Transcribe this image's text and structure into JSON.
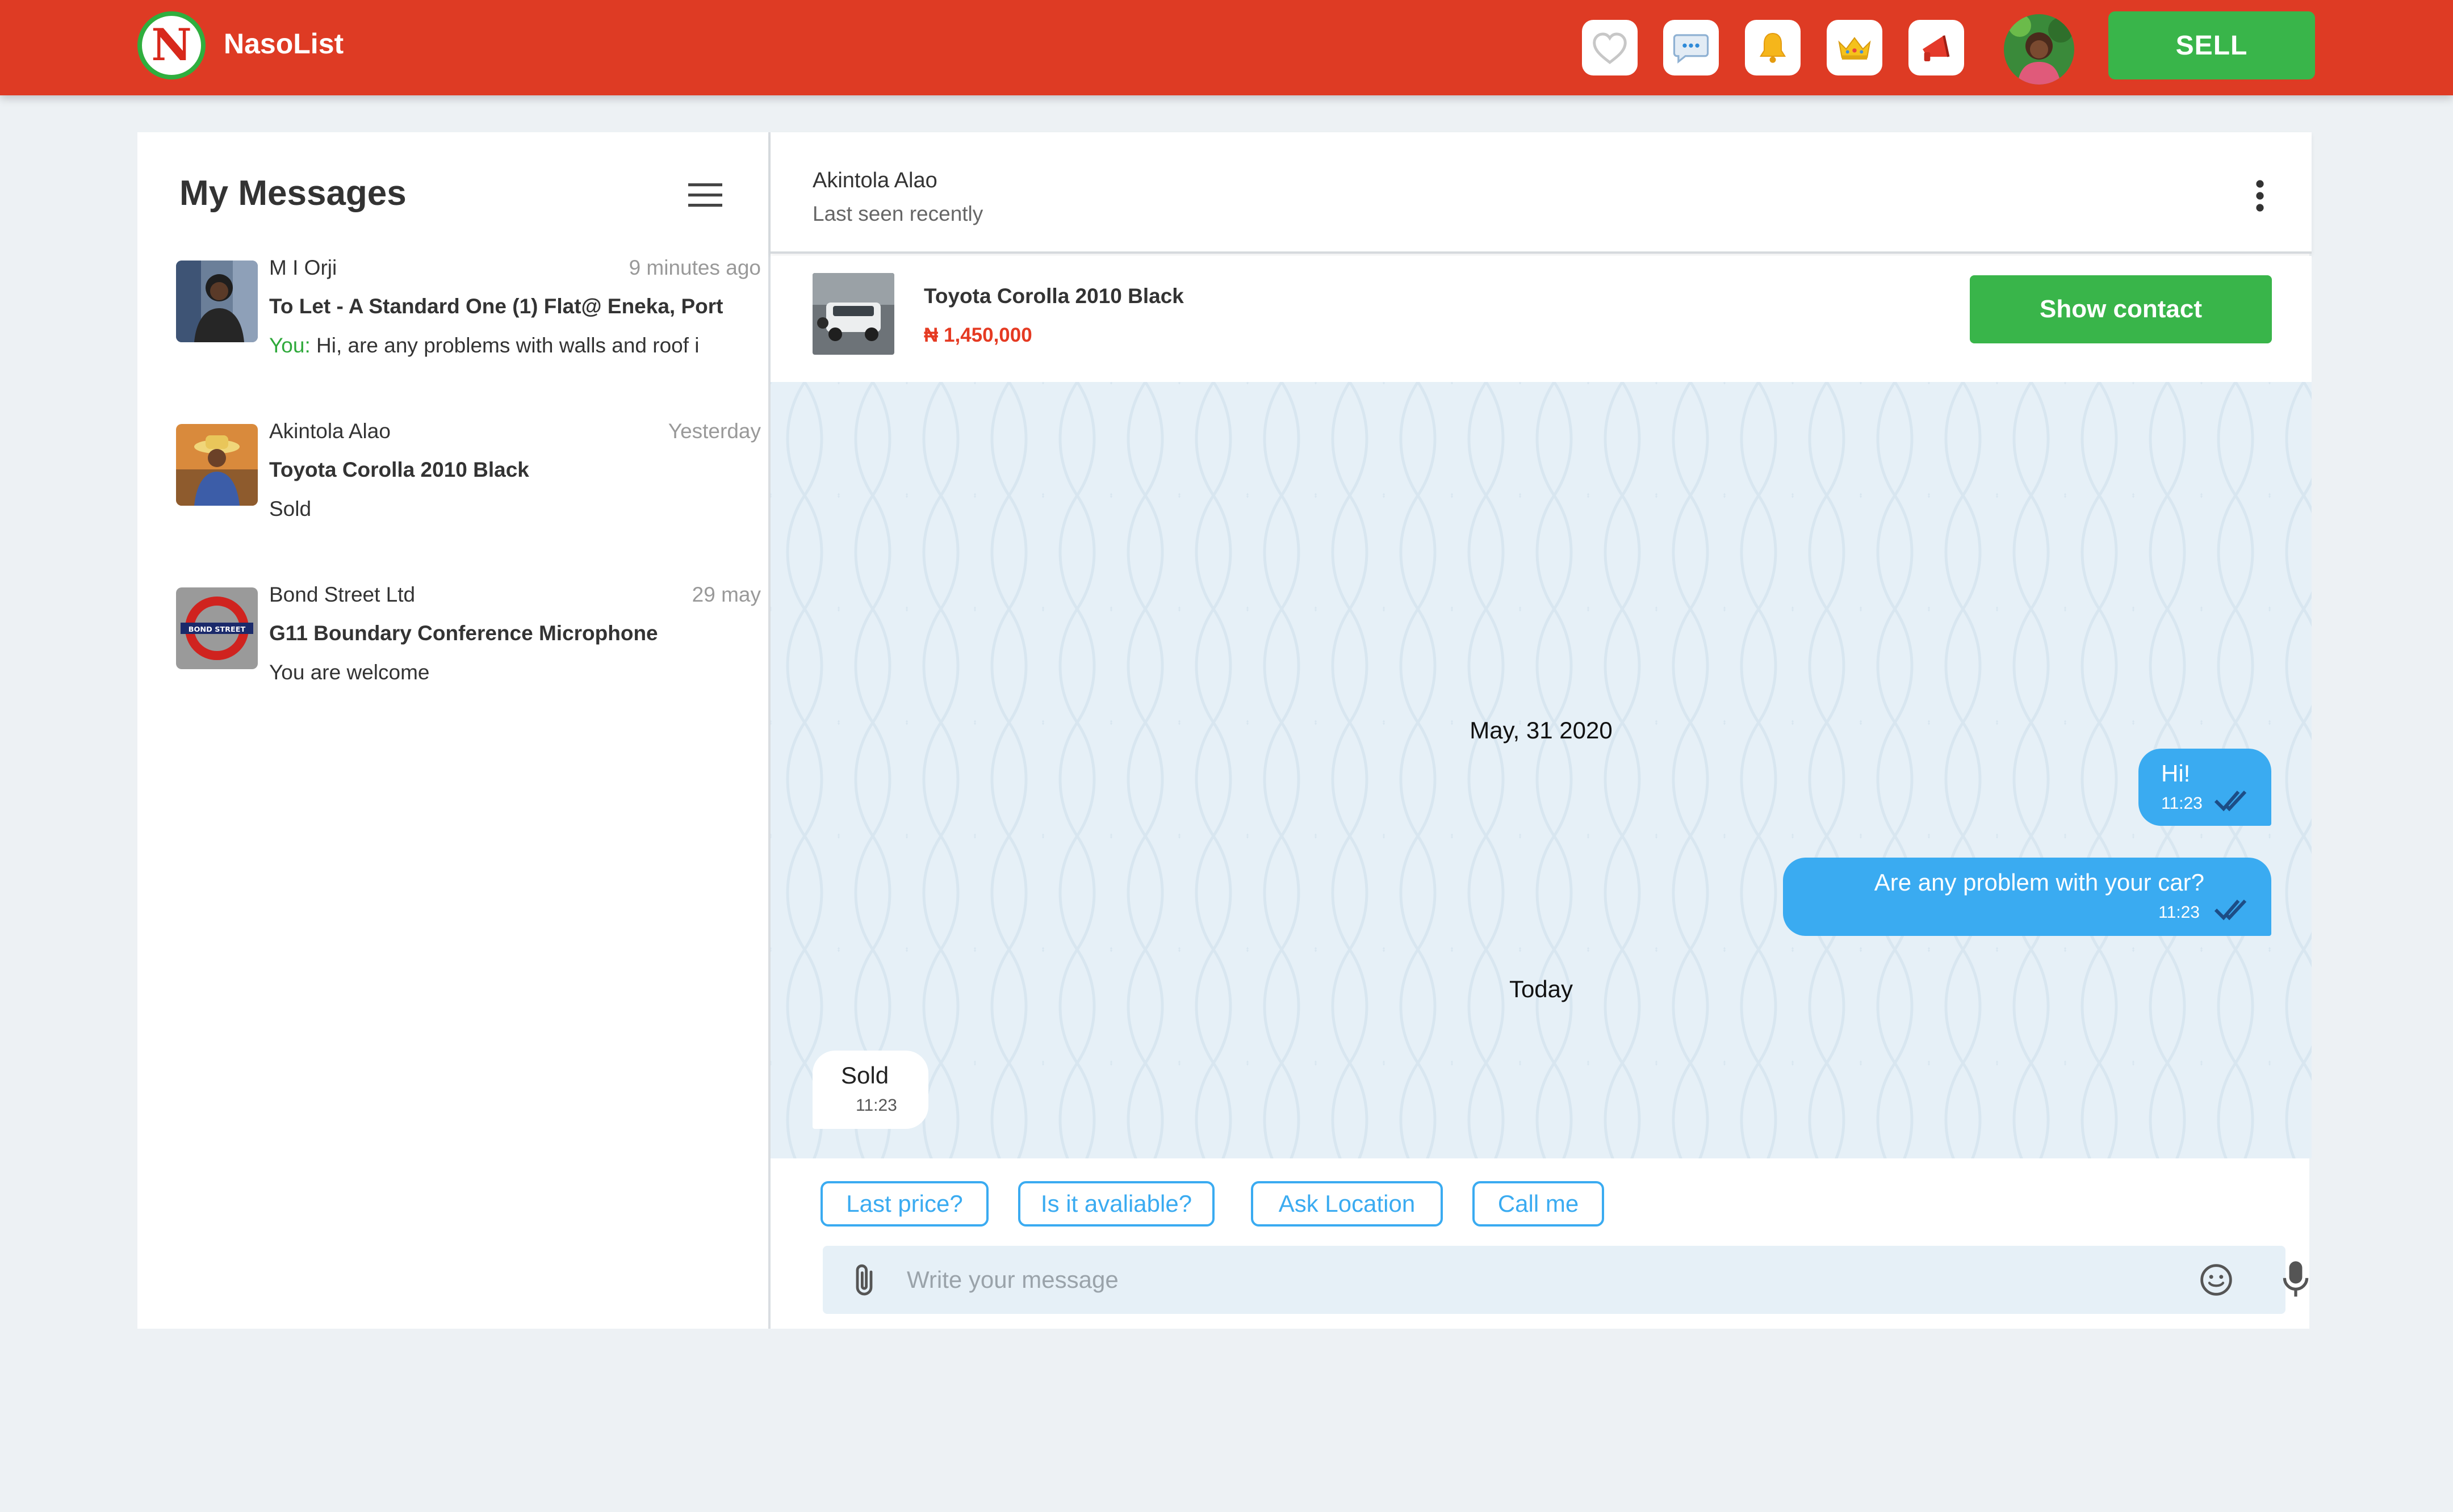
{
  "app": {
    "brand": "NasoList",
    "logo_letter": "N",
    "sell_label": "SELL",
    "nav_icons": [
      "heart-icon",
      "chat-bubble-icon",
      "bell-icon",
      "crown-icon",
      "megaphone-icon"
    ],
    "colors": {
      "topbar": "#de3b24",
      "accent_green": "#39b54a",
      "bubble_blue": "#3aabf1",
      "price_red": "#e53a22"
    }
  },
  "sidebar": {
    "title": "My Messages",
    "conversations": [
      {
        "name": "M I Orji",
        "time": "9 minutes ago",
        "title": "To Let - A Standard One (1) Flat@ Eneka, Port",
        "preview_prefix": "You:",
        "preview": " Hi, are any problems with walls and roof i"
      },
      {
        "name": "Akintola Alao",
        "time": "Yesterday",
        "title": "Toyota Corolla 2010 Black",
        "preview_prefix": "",
        "preview": "Sold"
      },
      {
        "name": "Bond Street Ltd",
        "time": "29 may",
        "title": "G11 Boundary Conference Microphone",
        "preview_prefix": "",
        "preview": "You are welcome",
        "avatar_text": "BOND STREET"
      }
    ]
  },
  "chat": {
    "contact_name": "Akintola Alao",
    "status": "Last seen recently",
    "product": {
      "title": "Toyota Corolla 2010 Black",
      "price": "₦ 1,450,000"
    },
    "show_contact_label": "Show contact",
    "date_1": "May, 31 2020",
    "date_2": "Today",
    "messages": [
      {
        "text": "Hi!",
        "time": "11:23",
        "direction": "out"
      },
      {
        "text": "Are any problem with your car?",
        "time": "11:23",
        "direction": "out"
      },
      {
        "text": "Sold",
        "time": "11:23",
        "direction": "in"
      }
    ],
    "quick_replies": [
      "Last price?",
      "Is it avaliable?",
      "Ask Location",
      "Call me"
    ],
    "composer_placeholder": "Write your message"
  }
}
